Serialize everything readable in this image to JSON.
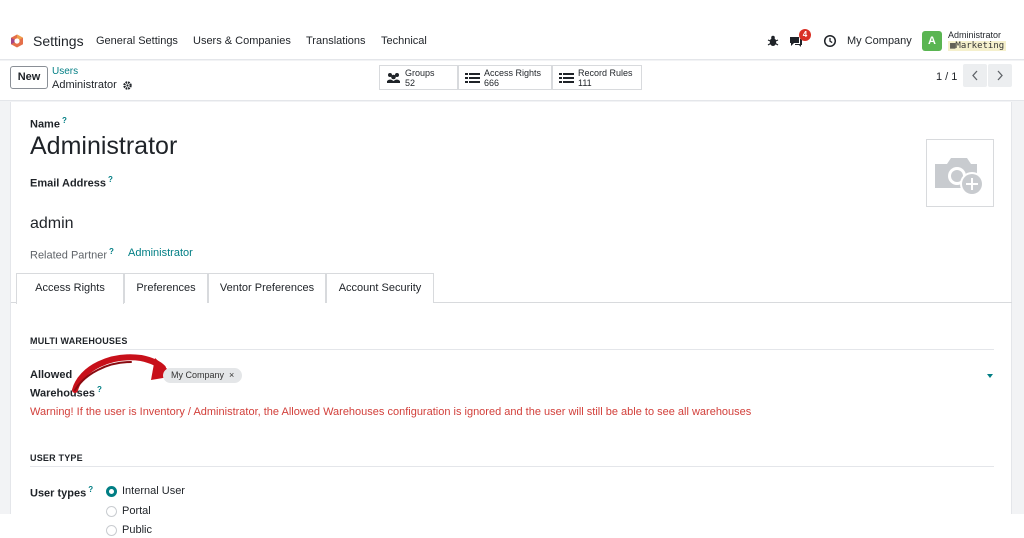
{
  "nav": {
    "app_name": "Settings",
    "menu": [
      "General Settings",
      "Users & Companies",
      "Translations",
      "Technical"
    ],
    "messages_count": "4",
    "company": "My Company",
    "avatar_letter": "A",
    "user_name": "Administrator",
    "database": "Marketing"
  },
  "control_panel": {
    "new_label": "New",
    "breadcrumb_parent": "Users",
    "breadcrumb_current": "Administrator",
    "smart_buttons": [
      {
        "label": "Groups",
        "count": "52",
        "icon": "users-icon"
      },
      {
        "label": "Access Rights",
        "count": "666",
        "icon": "list-icon"
      },
      {
        "label": "Record Rules",
        "count": "111",
        "icon": "list-icon"
      }
    ],
    "pager": "1 / 1"
  },
  "form": {
    "name_label": "Name",
    "name_value": "Administrator",
    "email_label": "Email Address",
    "email_value": "admin",
    "related_partner_label": "Related Partner",
    "related_partner_value": "Administrator",
    "question_mark": "?"
  },
  "tabs": [
    "Access Rights",
    "Preferences",
    "Ventor Preferences",
    "Account Security"
  ],
  "multi_warehouses": {
    "title": "MULTI WAREHOUSES",
    "label_line1": "Allowed",
    "label_line2": "Warehouses",
    "tag": "My Company",
    "tag_remove": "×",
    "warning": "Warning! If the user is Inventory / Administrator, the Allowed Warehouses configuration is ignored and the user will still be able to see all warehouses"
  },
  "user_type": {
    "title": "USER TYPE",
    "label": "User types",
    "options": [
      "Internal User",
      "Portal",
      "Public"
    ],
    "selected": "Internal User"
  },
  "colors": {
    "accent": "#017e84",
    "warning": "#d23f3a",
    "arrow": "#c8101a"
  }
}
